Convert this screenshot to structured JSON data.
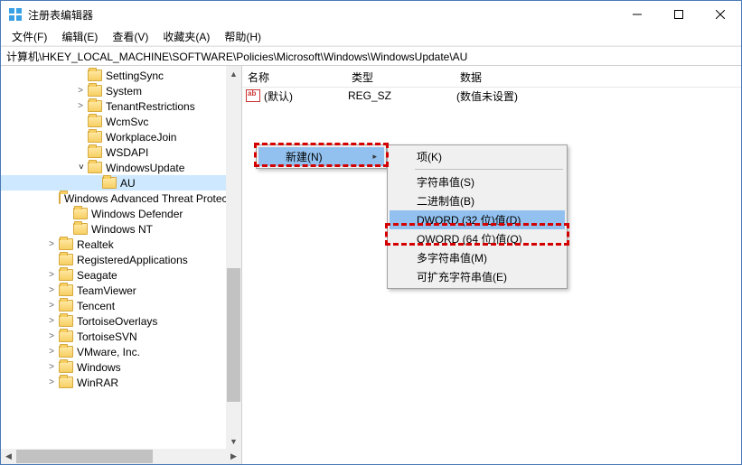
{
  "window": {
    "title": "注册表编辑器",
    "menus": {
      "file": "文件(F)",
      "edit": "编辑(E)",
      "view": "查看(V)",
      "favorites": "收藏夹(A)",
      "help": "帮助(H)"
    },
    "address": "计算机\\HKEY_LOCAL_MACHINE\\SOFTWARE\\Policies\\Microsoft\\Windows\\WindowsUpdate\\AU"
  },
  "tree": {
    "items": [
      {
        "indent": 5,
        "exp": "none",
        "label": "SettingSync"
      },
      {
        "indent": 5,
        "exp": "exp",
        "label": "System"
      },
      {
        "indent": 5,
        "exp": "exp",
        "label": "TenantRestrictions"
      },
      {
        "indent": 5,
        "exp": "none",
        "label": "WcmSvc"
      },
      {
        "indent": 5,
        "exp": "none",
        "label": "WorkplaceJoin"
      },
      {
        "indent": 5,
        "exp": "none",
        "label": "WSDAPI"
      },
      {
        "indent": 5,
        "exp": "col",
        "label": "WindowsUpdate"
      },
      {
        "indent": 6,
        "exp": "none",
        "label": "AU",
        "selected": true
      },
      {
        "indent": 4,
        "exp": "none",
        "label": "Windows Advanced Threat Protection"
      },
      {
        "indent": 4,
        "exp": "none",
        "label": "Windows Defender"
      },
      {
        "indent": 4,
        "exp": "none",
        "label": "Windows NT"
      },
      {
        "indent": 3,
        "exp": "exp",
        "label": "Realtek"
      },
      {
        "indent": 3,
        "exp": "none",
        "label": "RegisteredApplications"
      },
      {
        "indent": 3,
        "exp": "exp",
        "label": "Seagate"
      },
      {
        "indent": 3,
        "exp": "exp",
        "label": "TeamViewer"
      },
      {
        "indent": 3,
        "exp": "exp",
        "label": "Tencent"
      },
      {
        "indent": 3,
        "exp": "exp",
        "label": "TortoiseOverlays"
      },
      {
        "indent": 3,
        "exp": "exp",
        "label": "TortoiseSVN"
      },
      {
        "indent": 3,
        "exp": "exp",
        "label": "VMware, Inc."
      },
      {
        "indent": 3,
        "exp": "exp",
        "label": "Windows"
      },
      {
        "indent": 3,
        "exp": "exp",
        "label": "WinRAR"
      }
    ]
  },
  "list": {
    "columns": {
      "name": "名称",
      "type": "类型",
      "data": "数据"
    },
    "rows": [
      {
        "name": "(默认)",
        "type": "REG_SZ",
        "data": "(数值未设置)"
      }
    ]
  },
  "contextmenu": {
    "main": {
      "new": "新建(N)"
    },
    "sub": {
      "key": "项(K)",
      "string": "字符串值(S)",
      "binary": "二进制值(B)",
      "dword": "DWORD (32 位)值(D)",
      "qword": "QWORD (64 位)值(Q)",
      "multi": "多字符串值(M)",
      "expand": "可扩充字符串值(E)"
    }
  }
}
